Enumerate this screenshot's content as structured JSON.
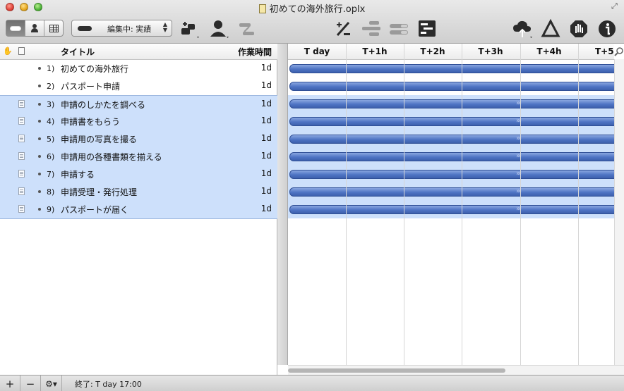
{
  "window": {
    "title": "初めての海外旅行.oplx"
  },
  "toolbar": {
    "baseline_popup": "編集中: 実績"
  },
  "outline": {
    "columns": {
      "title": "タイトル",
      "duration": "作業時間"
    },
    "rows": [
      {
        "num": "1)",
        "title": "初めての海外旅行",
        "duration": "1d",
        "selected": false,
        "has_note": false
      },
      {
        "num": "2)",
        "title": "パスポート申請",
        "duration": "1d",
        "selected": false,
        "has_note": false
      },
      {
        "num": "3)",
        "title": "申請のしかたを調べる",
        "duration": "1d",
        "selected": true,
        "has_note": true
      },
      {
        "num": "4)",
        "title": "申請書をもらう",
        "duration": "1d",
        "selected": true,
        "has_note": true
      },
      {
        "num": "5)",
        "title": "申請用の写真を撮る",
        "duration": "1d",
        "selected": true,
        "has_note": true
      },
      {
        "num": "6)",
        "title": "申請用の各種書類を揃える",
        "duration": "1d",
        "selected": true,
        "has_note": true
      },
      {
        "num": "7)",
        "title": "申請する",
        "duration": "1d",
        "selected": true,
        "has_note": true
      },
      {
        "num": "8)",
        "title": "申請受理・発行処理",
        "duration": "1d",
        "selected": true,
        "has_note": true
      },
      {
        "num": "9)",
        "title": "パスポートが届く",
        "duration": "1d",
        "selected": true,
        "has_note": true
      }
    ]
  },
  "gantt": {
    "columns": [
      "T day",
      "T+1h",
      "T+2h",
      "T+3h",
      "T+4h",
      "T+5"
    ],
    "bar_color": "#4e74c4",
    "selection_color": "#cde0fb"
  },
  "statusbar": {
    "add_label": "+",
    "remove_label": "−",
    "status": "終了: T day 17:00"
  }
}
